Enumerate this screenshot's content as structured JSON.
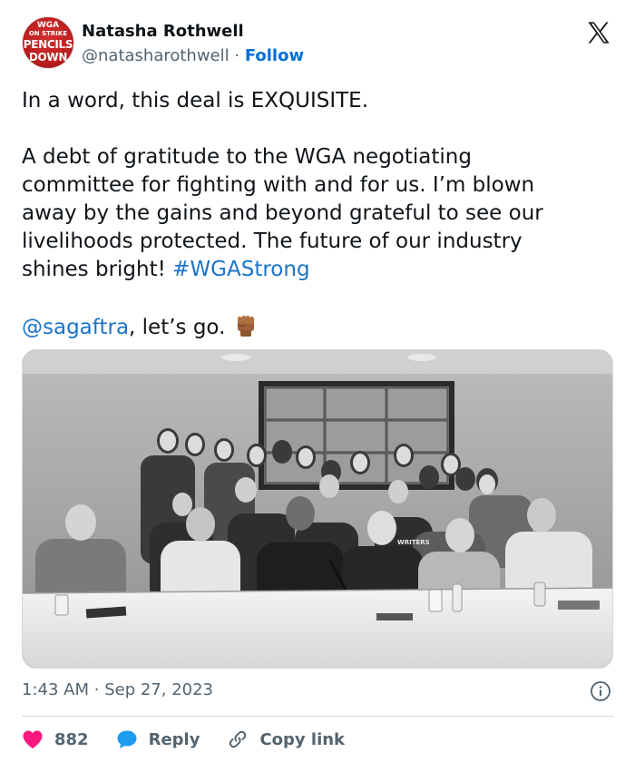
{
  "author": {
    "avatar_lines": [
      "WGA",
      "ON STRIKE",
      "PENCILS",
      "DOWN"
    ],
    "name": "Natasha Rothwell",
    "handle": "@natasharothwell",
    "separator": "·",
    "follow_label": "Follow"
  },
  "tweet": {
    "line1": "In a word, this deal is EXQUISITE.",
    "para2": "A debt of gratitude to the WGA negotiating\ncommittee for fighting with and for us. I’m blown\naway by the gains and beyond grateful to see our\nlivelihoods protected. The future of our industry\nshines bright! ",
    "hashtag": "#WGAStrong",
    "mention": "@sagaftra",
    "tail": ", let’s go. "
  },
  "photo": {
    "shirt_text": "WRITERS"
  },
  "meta": {
    "time": "1:43 AM",
    "separator": "·",
    "date": "Sep 27, 2023"
  },
  "actions": {
    "like_count": "882",
    "reply_label": "Reply",
    "copy_label": "Copy link"
  },
  "colors": {
    "link": "#1a73c8",
    "follow": "#006fd6",
    "like": "#f91880",
    "reply": "#1d9bf0",
    "muted": "#536471"
  }
}
